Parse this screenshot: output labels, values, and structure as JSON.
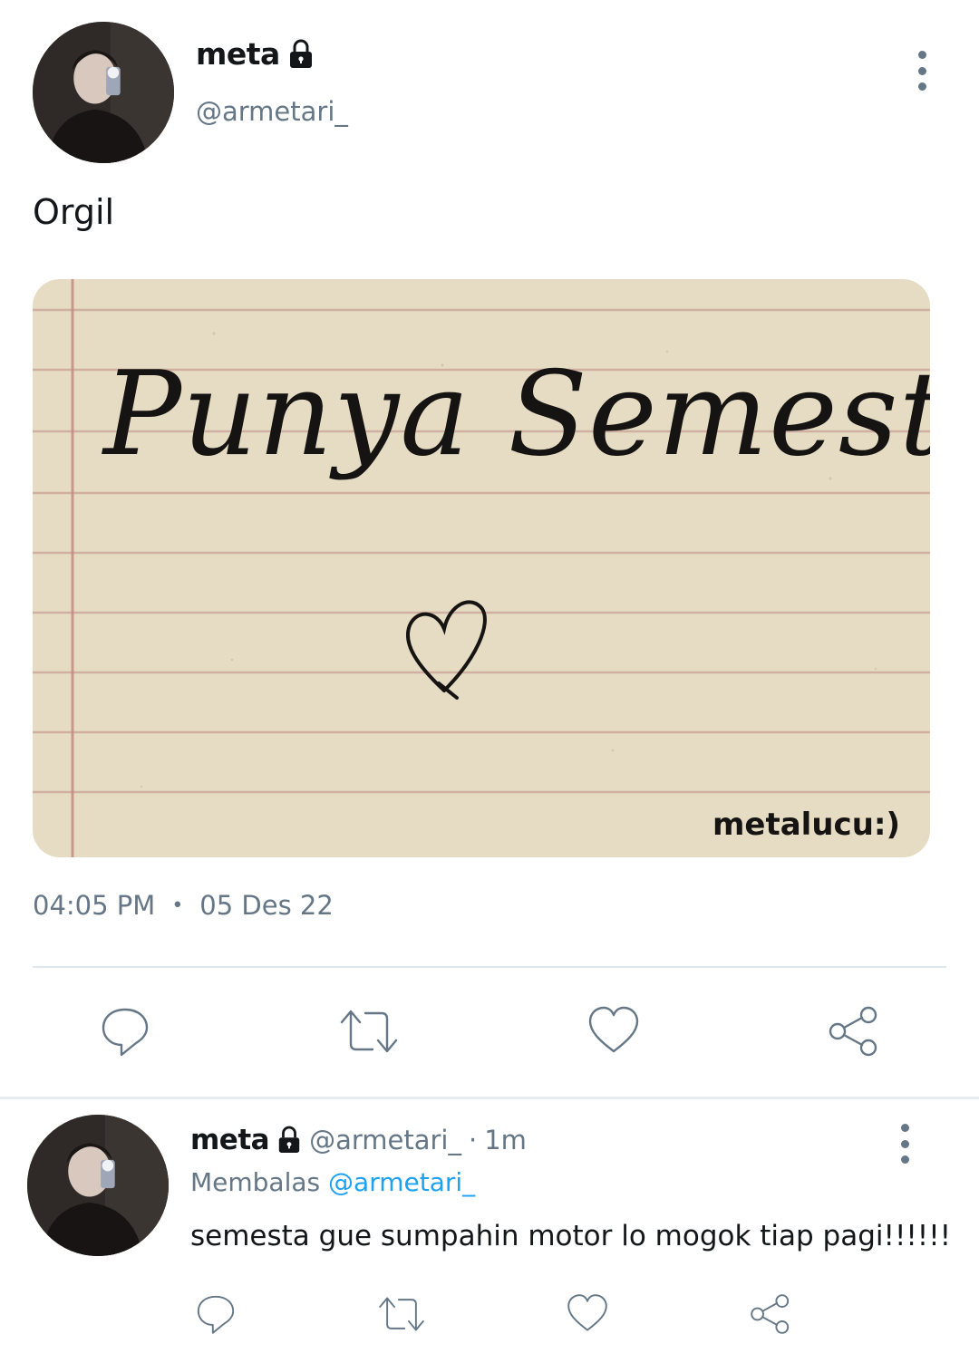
{
  "tweet": {
    "author": {
      "display_name": "meta",
      "handle": "@armetari_",
      "verified_icon": "lock-icon"
    },
    "text": "Orgil",
    "media": {
      "handwriting_title": "Punya Semesta",
      "signature": "metalucu:)",
      "drawn_icon": "heart-icon"
    },
    "time": "04:05 PM",
    "separator": "•",
    "date": "05 Des 22",
    "actions": [
      "reply-icon",
      "retweet-icon",
      "like-icon",
      "share-icon"
    ]
  },
  "reply": {
    "author": {
      "display_name": "meta",
      "handle": "@armetari_",
      "verified_icon": "lock-icon"
    },
    "separator": "·",
    "time": "1m",
    "replying_prefix": "Membalas",
    "replying_to": "@armetari_",
    "text": "semesta gue sumpahin motor lo mogok tiap pagi!!!!!!",
    "actions": [
      "reply-icon",
      "retweet-icon",
      "like-icon",
      "share-icon"
    ]
  },
  "colors": {
    "text_primary": "#14171a",
    "text_secondary": "#657786",
    "link": "#1da1f2",
    "divider": "#e1e8ed",
    "paper": "#e6dcc3",
    "paper_line": "#c49a8c"
  }
}
